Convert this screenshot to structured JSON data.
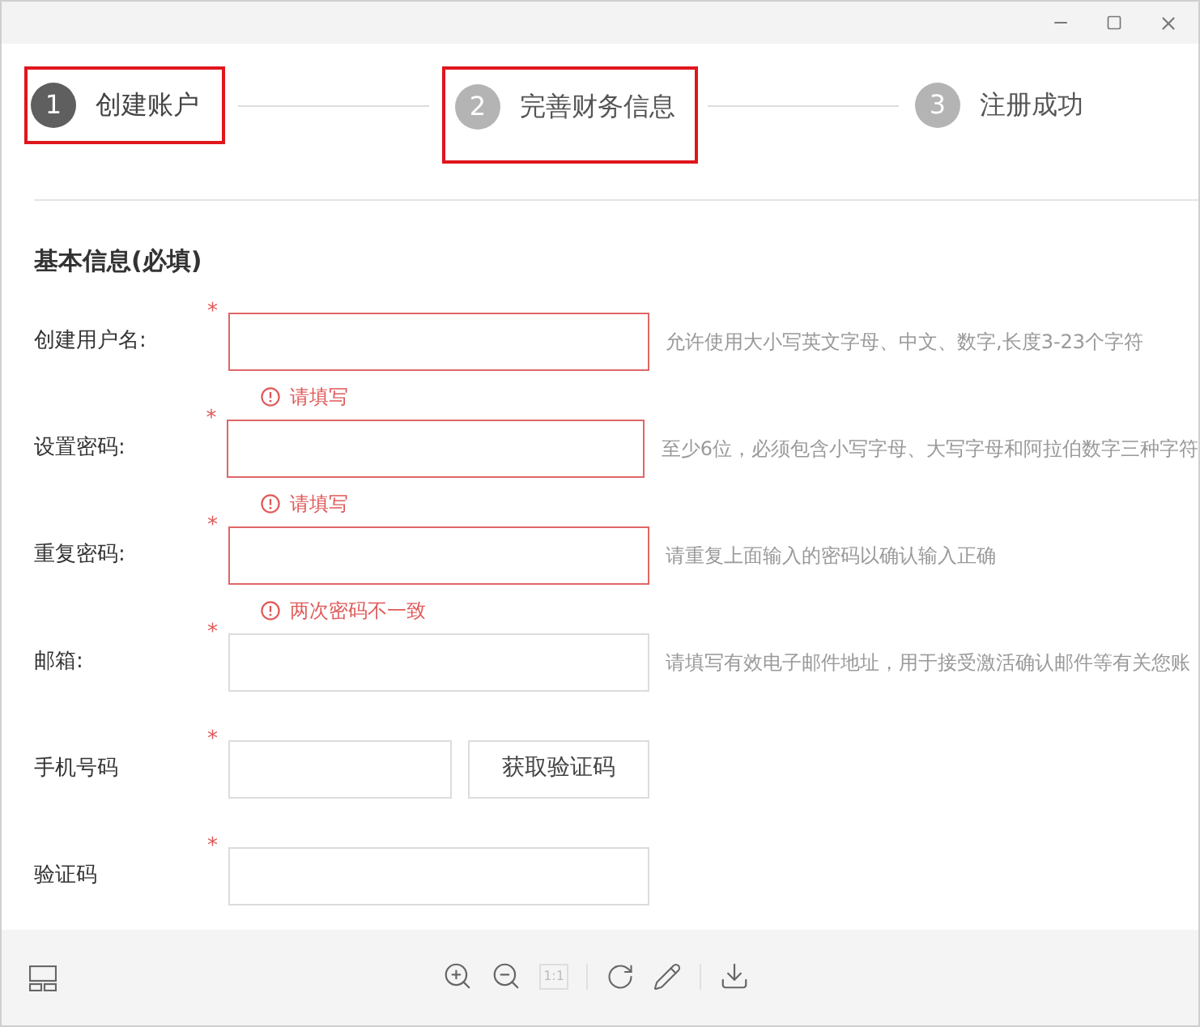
{
  "steps": [
    {
      "number": "1",
      "label": "创建账户",
      "selected": true,
      "highlighted": true
    },
    {
      "number": "2",
      "label": "完善财务信息",
      "selected": false,
      "highlighted": true
    },
    {
      "number": "3",
      "label": "注册成功",
      "selected": false,
      "highlighted": false
    }
  ],
  "section_title": "基本信息(必填)",
  "fields": [
    {
      "label": "创建用户名:",
      "required_mark": "*",
      "invalid": true,
      "error": "请填写",
      "hint": "允许使用大小写英文字母、中文、数字,长度3-23个字符"
    },
    {
      "label": "设置密码:",
      "required_mark": "*",
      "invalid": true,
      "error": "请填写",
      "hint": "至少6位，必须包含小写字母、大写字母和阿拉伯数字三种字符"
    },
    {
      "label": "重复密码:",
      "required_mark": "*",
      "invalid": true,
      "error": "两次密码不一致",
      "hint": "请重复上面输入的密码以确认输入正确"
    },
    {
      "label": "邮箱:",
      "required_mark": "*",
      "invalid": false,
      "hint": "请填写有效电子邮件地址，用于接受激活确认邮件等有关您账"
    },
    {
      "label": "手机号码",
      "required_mark": "*",
      "invalid": false,
      "button": "获取验证码"
    },
    {
      "label": "验证码",
      "required_mark": "*",
      "invalid": false
    }
  ],
  "toolbar": {
    "actual_size": {
      "label": "1:1",
      "disabled": true
    }
  }
}
